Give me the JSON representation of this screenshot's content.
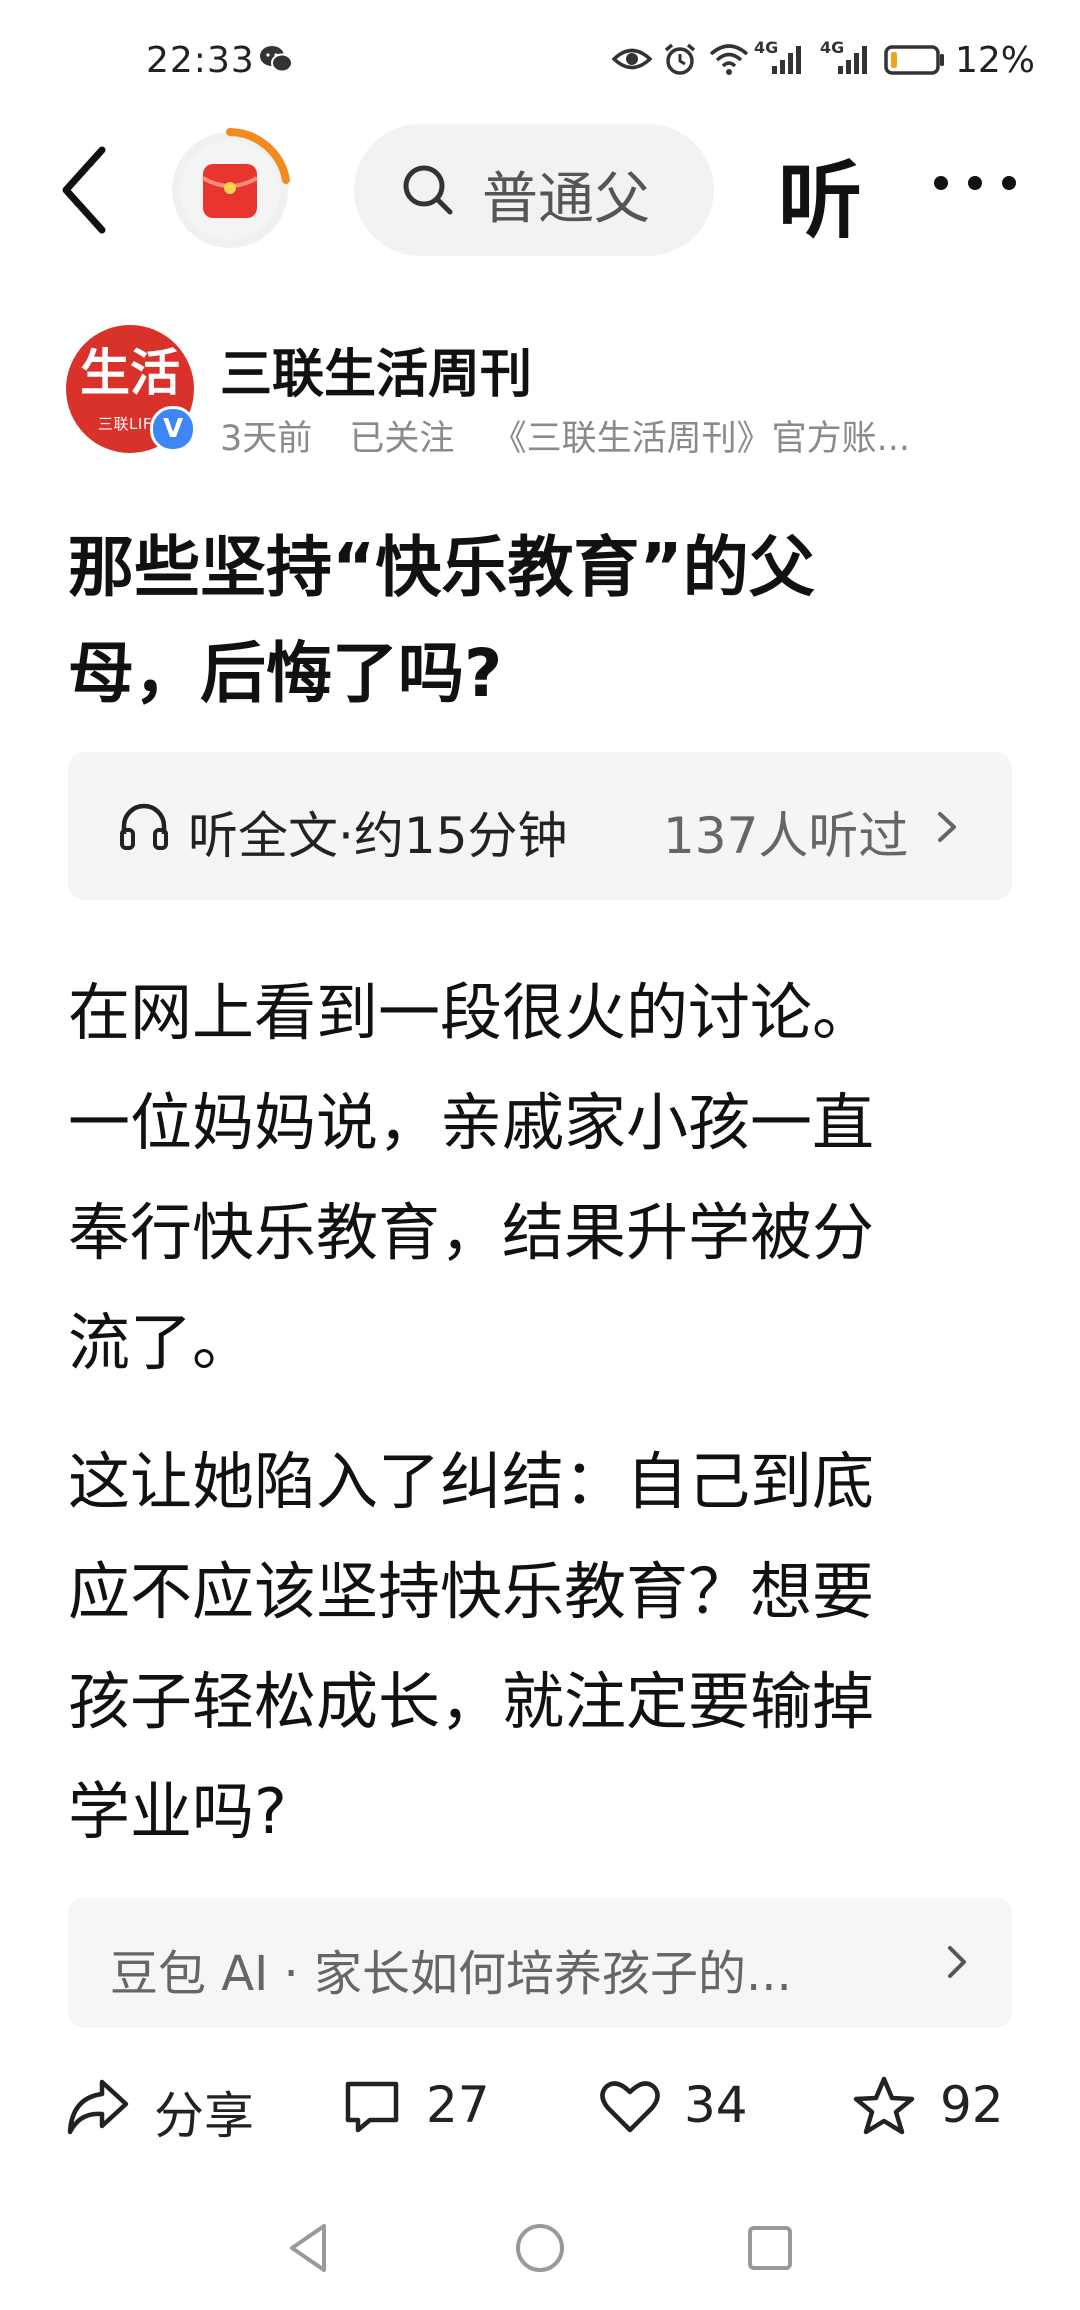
{
  "status_bar": {
    "time": "22:33",
    "signal_1": "4G",
    "signal_2": "4G",
    "battery_percent": "12%",
    "battery_level": 0.12
  },
  "top_nav": {
    "search_text": "普通父",
    "listen_label": "听"
  },
  "author": {
    "avatar_main": "生活",
    "avatar_sub": "三联LIFE",
    "verified_mark": "V",
    "name": "三联生活周刊",
    "time_ago": "3天前",
    "follow_status": "已关注",
    "description": "《三联生活周刊》官方账..."
  },
  "article": {
    "title_line1": "那些坚持“快乐教育”的父",
    "title_line2": "母，后悔了吗?",
    "listen_card": {
      "label": "听全文·约15分钟",
      "count": "137人听过"
    },
    "paragraph1_lines": [
      "在网上看到一段很火的讨论。",
      "一位妈妈说，亲戚家小孩一直",
      "奉行快乐教育，结果升学被分",
      "流了。"
    ],
    "paragraph2_lines": [
      "这让她陷入了纠结：自己到底",
      "应不应该坚持快乐教育？想要",
      "孩子轻松成长，就注定要输掉",
      "学业吗?"
    ]
  },
  "ai_card": {
    "text": "豆包 AI · 家长如何培养孩子的..."
  },
  "actions": {
    "share_label": "分享",
    "comment_count": "27",
    "like_count": "34",
    "favorite_count": "92"
  },
  "colors": {
    "accent_red": "#e8352e",
    "avatar_red": "#d9322b",
    "verify_blue": "#3d86f5",
    "text_primary": "#111111",
    "text_secondary": "#8a8a8a",
    "card_bg": "#f5f5f7"
  },
  "icons": [
    "back-icon",
    "red-packet-icon",
    "search-icon",
    "more-icon",
    "headphone-icon",
    "chevron-right-icon",
    "share-icon",
    "comment-icon",
    "like-icon",
    "favorite-icon",
    "nav-back-icon",
    "nav-home-icon",
    "nav-recents-icon"
  ]
}
